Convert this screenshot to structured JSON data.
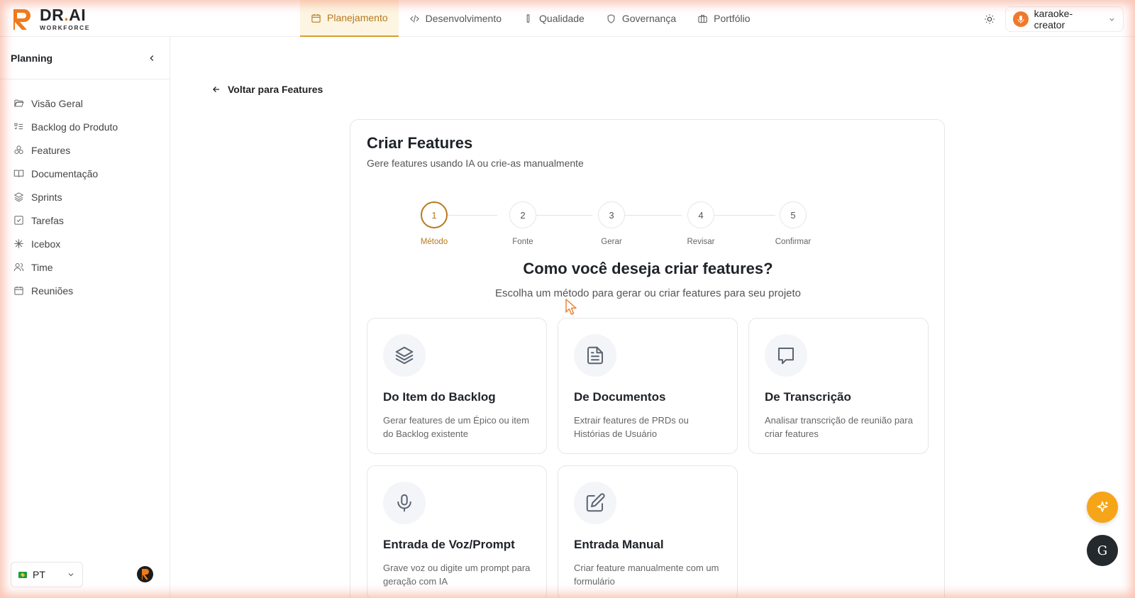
{
  "brand": {
    "name": "DR.AI",
    "name_main": "DR",
    "name_dot": ".",
    "name_tail": "AI",
    "subtitle": "WORKFORCE",
    "accent": "#f07a1a"
  },
  "nav": {
    "tabs": [
      {
        "label": "Planejamento",
        "icon": "calendar-icon",
        "active": true
      },
      {
        "label": "Desenvolvimento",
        "icon": "code-icon",
        "active": false
      },
      {
        "label": "Qualidade",
        "icon": "test-tube-icon",
        "active": false
      },
      {
        "label": "Governança",
        "icon": "shield-icon",
        "active": false
      },
      {
        "label": "Portfólio",
        "icon": "briefcase-icon",
        "active": false
      }
    ],
    "theme_icon": "sun-icon",
    "user": {
      "name": "karaoke-creator",
      "icon": "chevron-down-icon"
    }
  },
  "sidebar": {
    "title": "Planning",
    "collapse_icon": "chevron-left-icon",
    "items": [
      {
        "label": "Visão Geral",
        "icon": "folder-open-icon"
      },
      {
        "label": "Backlog do Produto",
        "icon": "list-todo-icon"
      },
      {
        "label": "Features",
        "icon": "shapes-icon"
      },
      {
        "label": "Documentação",
        "icon": "book-open-icon"
      },
      {
        "label": "Sprints",
        "icon": "layers-icon"
      },
      {
        "label": "Tarefas",
        "icon": "check-square-icon"
      },
      {
        "label": "Icebox",
        "icon": "snowflake-icon"
      },
      {
        "label": "Time",
        "icon": "users-icon"
      },
      {
        "label": "Reuniões",
        "icon": "calendar-icon"
      }
    ],
    "language": {
      "code": "PT",
      "flag": "brazil-flag-icon"
    }
  },
  "main": {
    "back_label": "Voltar para Features",
    "card": {
      "title": "Criar Features",
      "subtitle": "Gere features usando IA ou crie-as manualmente",
      "steps": [
        {
          "number": "1",
          "label": "Método",
          "active": true
        },
        {
          "number": "2",
          "label": "Fonte",
          "active": false
        },
        {
          "number": "3",
          "label": "Gerar",
          "active": false
        },
        {
          "number": "4",
          "label": "Revisar",
          "active": false
        },
        {
          "number": "5",
          "label": "Confirmar",
          "active": false
        }
      ],
      "question": "Como você deseja criar features?",
      "question_sub": "Escolha um método para gerar ou criar features para seu projeto",
      "options": [
        {
          "title": "Do Item do Backlog",
          "desc": "Gerar features de um Épico ou item do Backlog existente",
          "icon": "layers-icon"
        },
        {
          "title": "De Documentos",
          "desc": "Extrair features de PRDs ou Histórias de Usuário",
          "icon": "file-text-icon"
        },
        {
          "title": "De Transcrição",
          "desc": "Analisar transcrição de reunião para criar features",
          "icon": "message-square-icon"
        },
        {
          "title": "Entrada de Voz/Prompt",
          "desc": "Grave voz ou digite um prompt para geração com IA",
          "icon": "mic-icon"
        },
        {
          "title": "Entrada Manual",
          "desc": "Criar feature manualmente com um formulário",
          "icon": "edit-icon"
        }
      ]
    }
  },
  "floating": {
    "assistant_icon": "sparkles-icon",
    "g_button_label": "G"
  },
  "colors": {
    "active_accent": "#b7791f",
    "fab_accent": "#f6a418"
  }
}
